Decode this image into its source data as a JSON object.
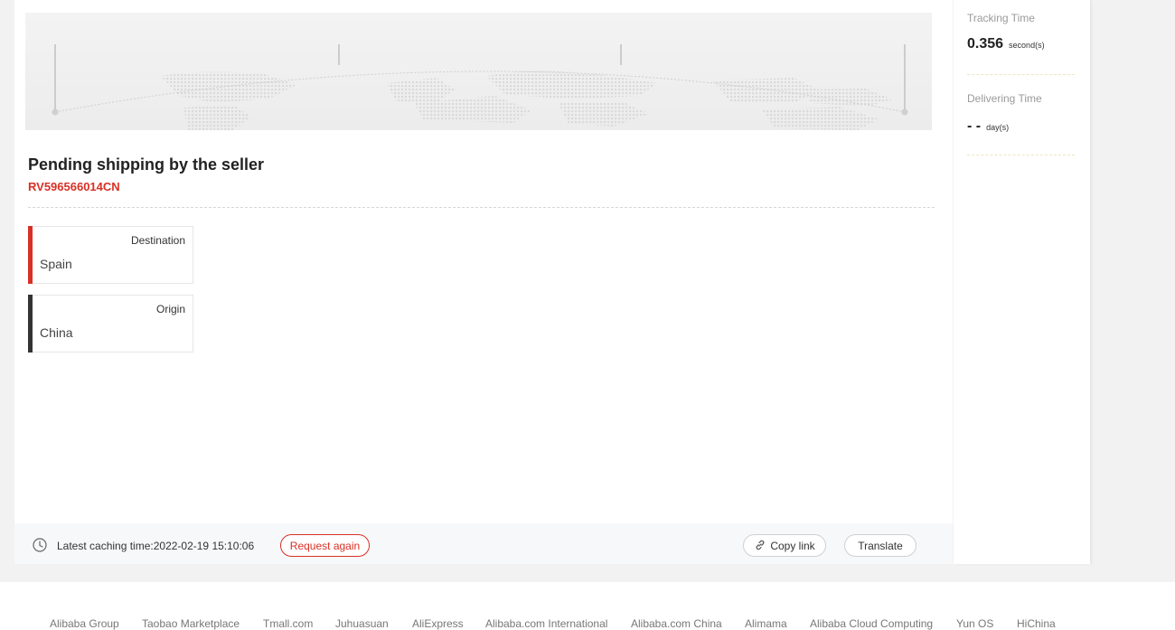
{
  "shipment": {
    "status_title": "Pending shipping by the seller",
    "tracking_number": "RV596566014CN",
    "destination": {
      "label": "Destination",
      "value": "Spain"
    },
    "origin": {
      "label": "Origin",
      "value": "China"
    }
  },
  "stats": {
    "tracking_time": {
      "label": "Tracking Time",
      "value": "0.356",
      "unit": "second(s)"
    },
    "delivering_time": {
      "label": "Delivering Time",
      "value": "- -",
      "unit": "day(s)"
    }
  },
  "footer_bar": {
    "caching_text": "Latest caching time:2022-02-19 15:10:06",
    "request_again": "Request again",
    "copy_link": "Copy link",
    "translate": "Translate"
  },
  "footer_links": [
    "Alibaba Group",
    "Taobao Marketplace",
    "Tmall.com",
    "Juhuasuan",
    "AliExpress",
    "Alibaba.com International",
    "Alibaba.com China",
    "Alimama",
    "Alibaba Cloud Computing",
    "Yun OS",
    "HiChina"
  ],
  "colors": {
    "accent": "#d93025",
    "origin_bar": "#333333"
  }
}
